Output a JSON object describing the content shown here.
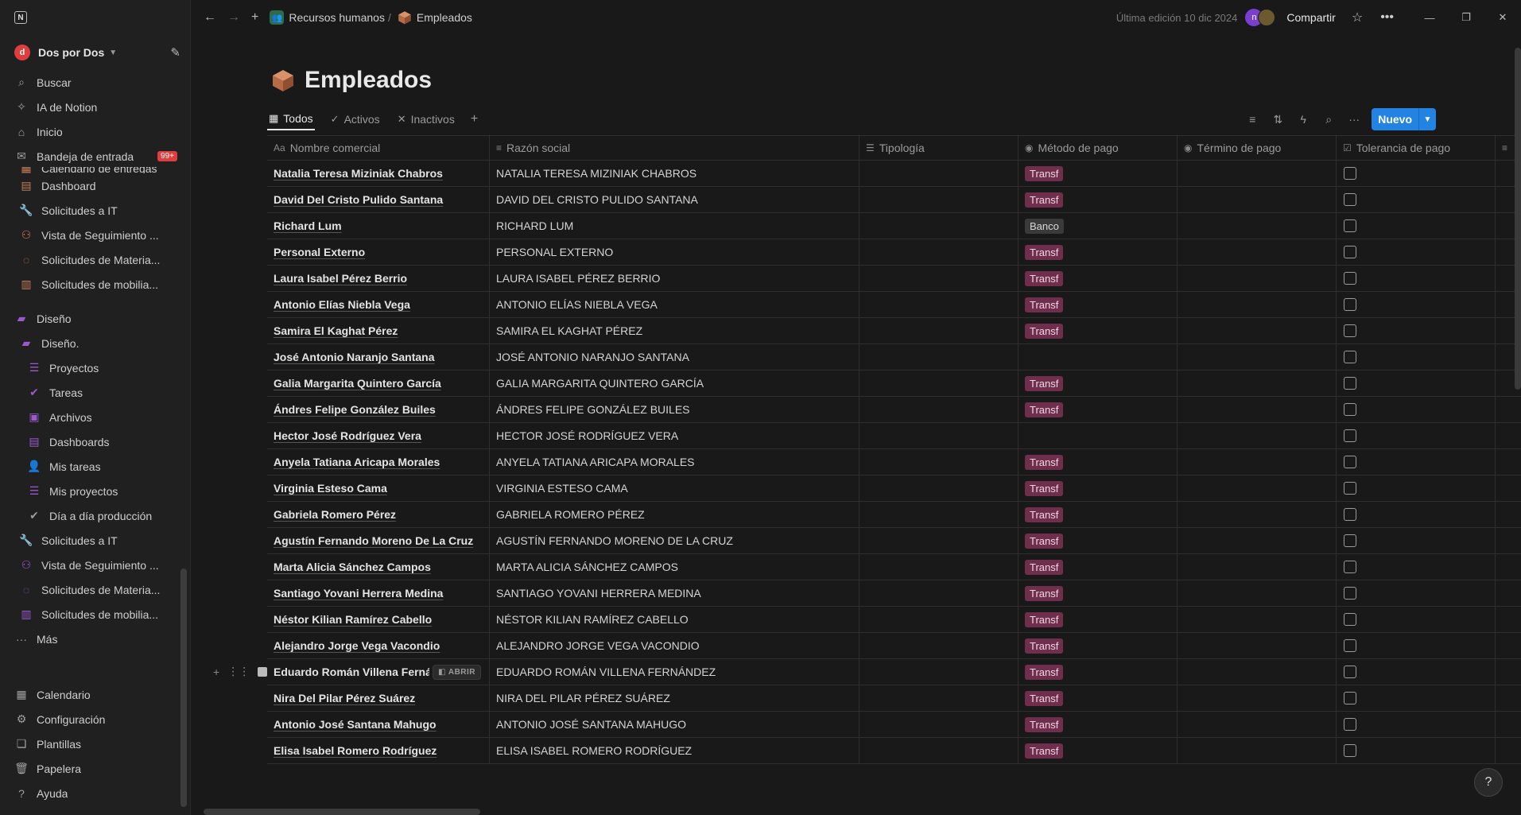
{
  "sidebar": {
    "workspace_initial": "d",
    "workspace_name": "Dos por Dos",
    "nav": [
      {
        "label": "Buscar",
        "icon": "search-icon"
      },
      {
        "label": "IA de Notion",
        "icon": "ai-icon"
      },
      {
        "label": "Inicio",
        "icon": "home-icon"
      },
      {
        "label": "Bandeja de entrada",
        "icon": "inbox-icon",
        "badge": "99+"
      }
    ],
    "tree_partial": "Calendario de entregas",
    "tree": [
      {
        "label": "Dashboard",
        "icon": "dashboard-icon",
        "color": "#c97d5b",
        "level": "sub"
      },
      {
        "label": "Solicitudes a IT",
        "icon": "wrench-icon",
        "color": "#c97d5b",
        "level": "sub"
      },
      {
        "label": "Vista de Seguimiento ...",
        "icon": "people-icon",
        "color": "#c97d5b",
        "level": "sub"
      },
      {
        "label": "Solicitudes de Materia...",
        "icon": "loading-icon",
        "color": "#c97d5b",
        "level": "sub"
      },
      {
        "label": "Solicitudes de mobilia...",
        "icon": "chair-icon",
        "color": "#c97d5b",
        "level": "sub"
      }
    ],
    "section": {
      "label": "Diseño",
      "icon": "brush-icon",
      "color": "#9b59d0"
    },
    "design_tree": [
      {
        "label": "Diseño.",
        "icon": "brush-icon",
        "color": "#9b59d0",
        "level": "sub"
      },
      {
        "label": "Proyectos",
        "icon": "stack-icon",
        "color": "#9b59d0",
        "level": "subsub"
      },
      {
        "label": "Tareas",
        "icon": "check-circle-icon",
        "color": "#9b59d0",
        "level": "subsub"
      },
      {
        "label": "Archivos",
        "icon": "archive-icon",
        "color": "#9b59d0",
        "level": "subsub"
      },
      {
        "label": "Dashboards",
        "icon": "dashboard-icon",
        "color": "#9b59d0",
        "level": "subsub"
      },
      {
        "label": "Mis tareas",
        "icon": "person-icon",
        "color": "#9b59d0",
        "level": "subsub"
      },
      {
        "label": "Mis proyectos",
        "icon": "stack-icon",
        "color": "#9b59d0",
        "level": "subsub"
      },
      {
        "label": "Día a día producción",
        "icon": "check-circle-icon",
        "color": "#9b9b9b",
        "level": "subsub"
      },
      {
        "label": "Solicitudes a IT",
        "icon": "wrench-icon",
        "color": "#9b59d0",
        "level": "sub"
      },
      {
        "label": "Vista de Seguimiento ...",
        "icon": "people-icon",
        "color": "#9b59d0",
        "level": "sub"
      },
      {
        "label": "Solicitudes de Materia...",
        "icon": "loading-icon",
        "color": "#9b59d0",
        "level": "sub"
      },
      {
        "label": "Solicitudes de mobilia...",
        "icon": "chair-icon",
        "color": "#9b59d0",
        "level": "sub"
      }
    ],
    "more": "Más",
    "bottom": [
      {
        "label": "Calendario",
        "icon": "calendar-icon"
      },
      {
        "label": "Configuración",
        "icon": "gear-icon"
      },
      {
        "label": "Plantillas",
        "icon": "templates-icon"
      },
      {
        "label": "Papelera",
        "icon": "trash-icon"
      },
      {
        "label": "Ayuda",
        "icon": "help-icon"
      }
    ]
  },
  "topbar": {
    "breadcrumb_parent": "Recursos humanos",
    "breadcrumb_current": "Empleados",
    "last_edit": "Última edición 10 dic 2024",
    "avatar_initial": "n",
    "share": "Compartir"
  },
  "page": {
    "title": "Empleados",
    "views": [
      {
        "label": "Todos",
        "icon": "table-icon",
        "active": true
      },
      {
        "label": "Activos",
        "icon": "check-icon",
        "active": false
      },
      {
        "label": "Inactivos",
        "icon": "x-icon",
        "active": false
      }
    ],
    "new_button": "Nuevo"
  },
  "table": {
    "columns": [
      {
        "label": "Nombre comercial",
        "icon": "Aa"
      },
      {
        "label": "Razón social",
        "icon": "≡"
      },
      {
        "label": "Tipología",
        "icon": "☰"
      },
      {
        "label": "Método de pago",
        "icon": "◉"
      },
      {
        "label": "Término de pago",
        "icon": "◉"
      },
      {
        "label": "Tolerancia de pago",
        "icon": "☑"
      }
    ],
    "open_label": "ABRIR",
    "rows": [
      {
        "name": "Natalia Teresa Miziniak Chabros",
        "razon": "NATALIA TERESA MIZINIAK CHABROS",
        "pago": "Transf"
      },
      {
        "name": "David Del Cristo Pulido Santana",
        "razon": "DAVID DEL CRISTO PULIDO SANTANA",
        "pago": "Transf"
      },
      {
        "name": "Richard Lum",
        "razon": "RICHARD LUM",
        "pago": "Banco"
      },
      {
        "name": "Personal Externo",
        "razon": "PERSONAL EXTERNO",
        "pago": "Transf"
      },
      {
        "name": "Laura Isabel Pérez Berrio",
        "razon": "LAURA ISABEL PÉREZ BERRIO",
        "pago": "Transf"
      },
      {
        "name": "Antonio Elías Niebla Vega",
        "razon": "ANTONIO ELÍAS NIEBLA VEGA",
        "pago": "Transf"
      },
      {
        "name": "Samira El Kaghat Pérez",
        "razon": "SAMIRA EL KAGHAT PÉREZ",
        "pago": "Transf"
      },
      {
        "name": "José Antonio Naranjo Santana",
        "razon": "JOSÉ ANTONIO NARANJO SANTANA",
        "pago": ""
      },
      {
        "name": "Galia Margarita Quintero García",
        "razon": "GALIA MARGARITA QUINTERO GARCÍA",
        "pago": "Transf"
      },
      {
        "name": "Ándres Felipe González Builes",
        "razon": "ÁNDRES FELIPE GONZÁLEZ BUILES",
        "pago": "Transf"
      },
      {
        "name": "Hector José Rodríguez Vera",
        "razon": "HECTOR JOSÉ RODRÍGUEZ VERA",
        "pago": ""
      },
      {
        "name": "Anyela Tatiana Aricapa Morales",
        "razon": "ANYELA TATIANA ARICAPA MORALES",
        "pago": "Transf"
      },
      {
        "name": "Virginia Esteso Cama",
        "razon": "VIRGINIA ESTESO CAMA",
        "pago": "Transf"
      },
      {
        "name": "Gabriela Romero Pérez",
        "razon": "GABRIELA ROMERO PÉREZ",
        "pago": "Transf"
      },
      {
        "name": "Agustín Fernando Moreno De La Cruz",
        "razon": "AGUSTÍN FERNANDO MORENO DE LA CRUZ",
        "pago": "Transf"
      },
      {
        "name": "Marta Alicia Sánchez Campos",
        "razon": "MARTA ALICIA SÁNCHEZ CAMPOS",
        "pago": "Transf"
      },
      {
        "name": "Santiago Yovani Herrera Medina",
        "razon": "SANTIAGO YOVANI HERRERA MEDINA",
        "pago": "Transf"
      },
      {
        "name": "Néstor Kilian Ramírez Cabello",
        "razon": "NÉSTOR KILIAN RAMÍREZ CABELLO",
        "pago": "Transf"
      },
      {
        "name": "Alejandro Jorge Vega Vacondio",
        "razon": "ALEJANDRO JORGE VEGA VACONDIO",
        "pago": "Transf"
      },
      {
        "name": "Eduardo Román Villena Fernández",
        "razon": "EDUARDO ROMÁN VILLENA FERNÁNDEZ",
        "pago": "Transf",
        "hover": true
      },
      {
        "name": "Nira Del Pilar Pérez Suárez",
        "razon": "NIRA DEL PILAR PÉREZ SUÁREZ",
        "pago": "Transf"
      },
      {
        "name": "Antonio José Santana Mahugo",
        "razon": "ANTONIO JOSÉ SANTANA MAHUGO",
        "pago": "Transf"
      },
      {
        "name": "Elisa Isabel Romero Rodríguez",
        "razon": "ELISA ISABEL ROMERO RODRÍGUEZ",
        "pago": "Transf"
      }
    ]
  }
}
